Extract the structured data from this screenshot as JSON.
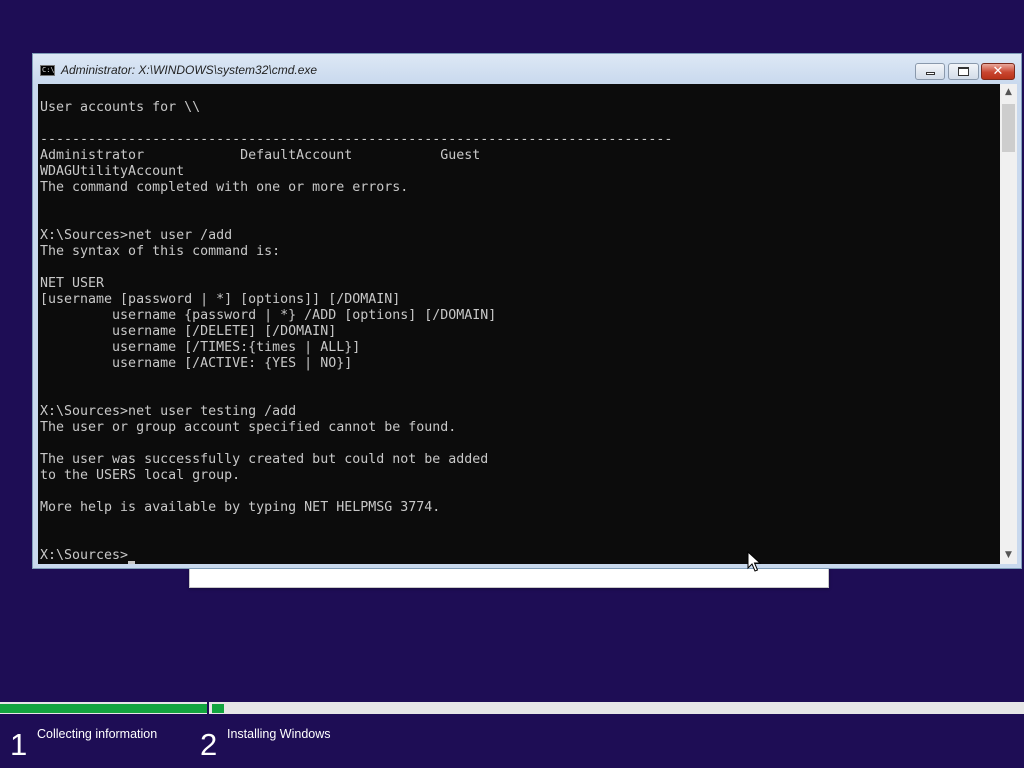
{
  "cmd": {
    "title": "Administrator: X:\\WINDOWS\\system32\\cmd.exe",
    "icon_label": "C:\\",
    "console_lines": [
      "User accounts for \\\\",
      "",
      "-------------------------------------------------------------------------------",
      "Administrator            DefaultAccount           Guest",
      "WDAGUtilityAccount",
      "The command completed with one or more errors.",
      "",
      "",
      "X:\\Sources>net user /add",
      "The syntax of this command is:",
      "",
      "NET USER",
      "[username [password | *] [options]] [/DOMAIN]",
      "         username {password | *} /ADD [options] [/DOMAIN]",
      "         username [/DELETE] [/DOMAIN]",
      "         username [/TIMES:{times | ALL}]",
      "         username [/ACTIVE: {YES | NO}]",
      "",
      "",
      "X:\\Sources>net user testing /add",
      "The user or group account specified cannot be found.",
      "",
      "The user was successfully created but could not be added",
      "to the USERS local group.",
      "",
      "More help is available by typing NET HELPMSG 3774.",
      "",
      "",
      "X:\\Sources>"
    ],
    "close_glyph": "✕",
    "scroll_up_glyph": "▲",
    "scroll_down_glyph": "▼"
  },
  "setup": {
    "steps": [
      {
        "number": "1",
        "label": "Collecting information"
      },
      {
        "number": "2",
        "label": "Installing Windows"
      }
    ],
    "progress": {
      "step1_fraction": 1.0,
      "step2_fraction": 0.015
    }
  },
  "colors": {
    "desktop": "#1e0d55",
    "console_bg": "#0c0c0c",
    "console_fg": "#c8c8c8",
    "progress_green": "#12a53f"
  }
}
